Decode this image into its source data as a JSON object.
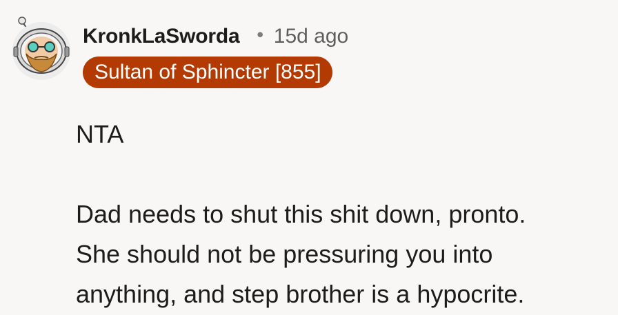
{
  "comment": {
    "username": "KronkLaSworda",
    "separator": "•",
    "timestamp": "15d ago",
    "flair": "Sultan of Sphincter [855]",
    "body": {
      "verdict": "NTA",
      "paragraph_lines": [
        "Dad needs to shut this shit down, pronto.",
        "She should not be pressuring you into",
        "anything, and step brother is a hypocrite."
      ]
    }
  },
  "colors": {
    "background": "#f9f7f5",
    "flair_background": "#b33b03",
    "flair_text": "#ffffff",
    "username_text": "#1c1c1c",
    "meta_text": "#5e5e5e"
  },
  "icons": {
    "avatar": "snoo-avatar-with-helmet-and-beard"
  }
}
